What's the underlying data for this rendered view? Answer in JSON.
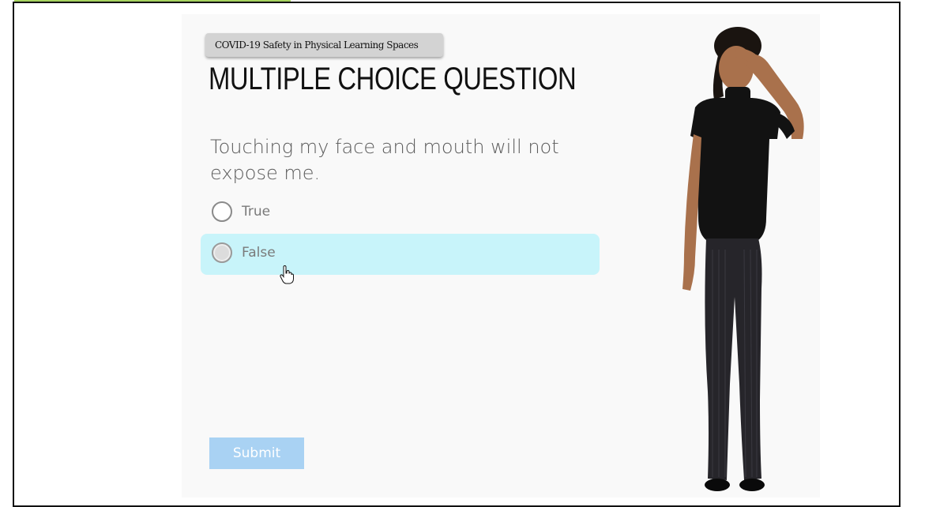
{
  "course": {
    "tag": "COVID-19 Safety in Physical Learning Spaces"
  },
  "question": {
    "heading": "MULTIPLE CHOICE QUESTION",
    "prompt": "Touching my face and mouth will not expose me.",
    "options": [
      {
        "label": "True",
        "hovered": false
      },
      {
        "label": "False",
        "hovered": true
      }
    ]
  },
  "actions": {
    "submit_label": "Submit"
  },
  "colors": {
    "hover_highlight": "#c8f4fa",
    "submit_button": "#a9d2f3",
    "tag_background": "#d3d3d3",
    "top_accent": "#a6d35f"
  },
  "icons": {
    "cursor": "hand-pointer-icon"
  }
}
